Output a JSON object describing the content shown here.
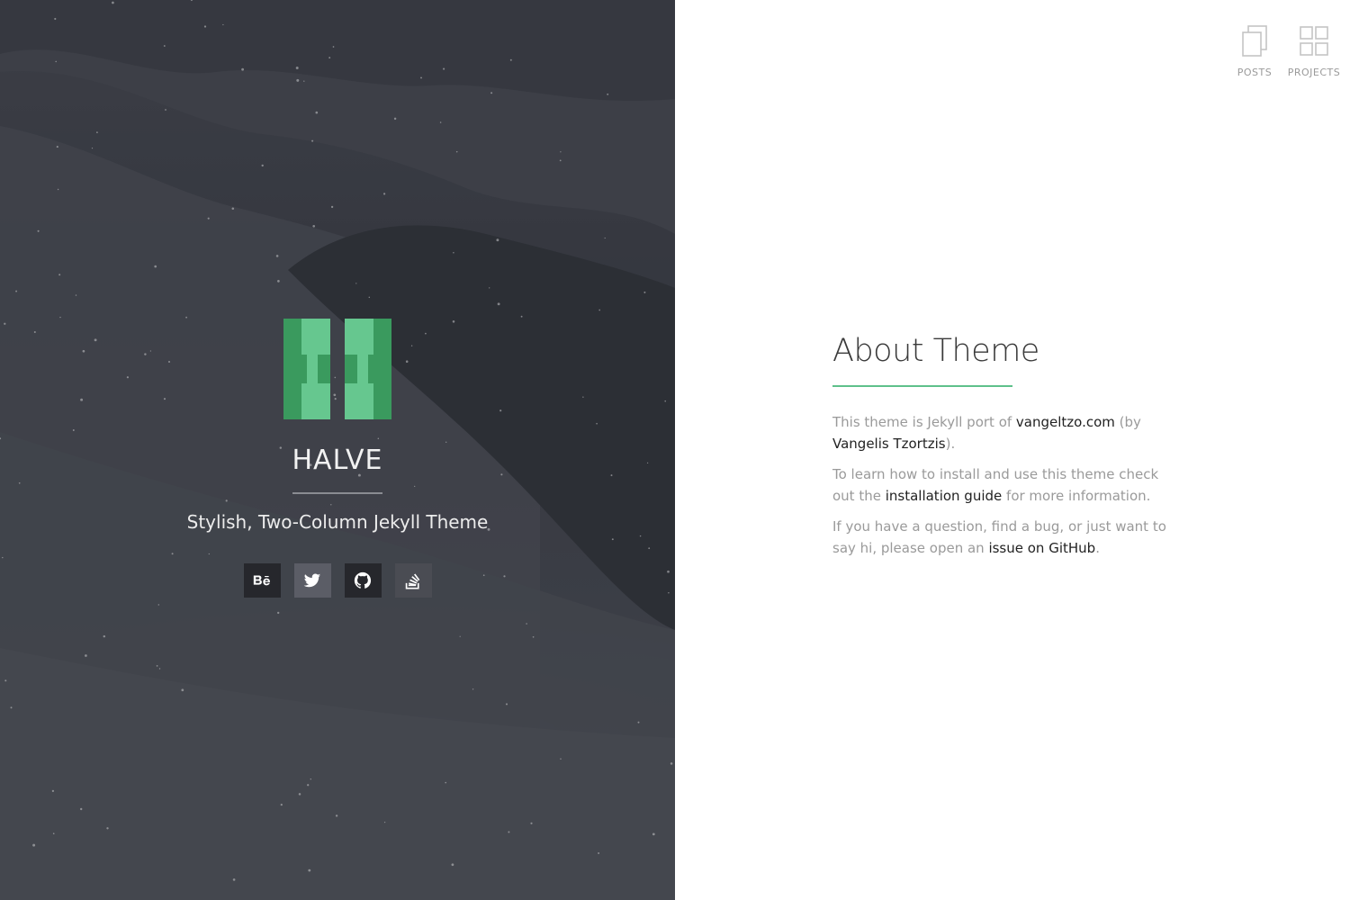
{
  "site": {
    "title": "HALVE",
    "tagline": "Stylish, Two-Column Jekyll Theme",
    "accent_color": "#5ec08a",
    "logo_colors": [
      "#3a9a5e",
      "#66c78f"
    ]
  },
  "socials": [
    {
      "name": "behance",
      "label": "Bē",
      "icon": "behance-icon"
    },
    {
      "name": "twitter",
      "icon": "twitter-icon"
    },
    {
      "name": "github",
      "icon": "github-icon"
    },
    {
      "name": "stackoverflow",
      "icon": "stackoverflow-icon"
    }
  ],
  "nav": {
    "posts_label": "POSTS",
    "projects_label": "PROJECTS"
  },
  "page": {
    "title": "About Theme",
    "p1": {
      "a": "This theme is Jekyll port of ",
      "link1": "vangeltzo.com",
      "b": " (by ",
      "link2": "Vangelis Tzortzis",
      "c": ")."
    },
    "p2": {
      "a": "To learn how to install and use this theme check out the ",
      "link": "installation guide",
      "b": " for more information."
    },
    "p3": {
      "a": "If you have a question, find a bug, or just want to say hi, please open an ",
      "link": "issue on GitHub",
      "b": "."
    }
  }
}
